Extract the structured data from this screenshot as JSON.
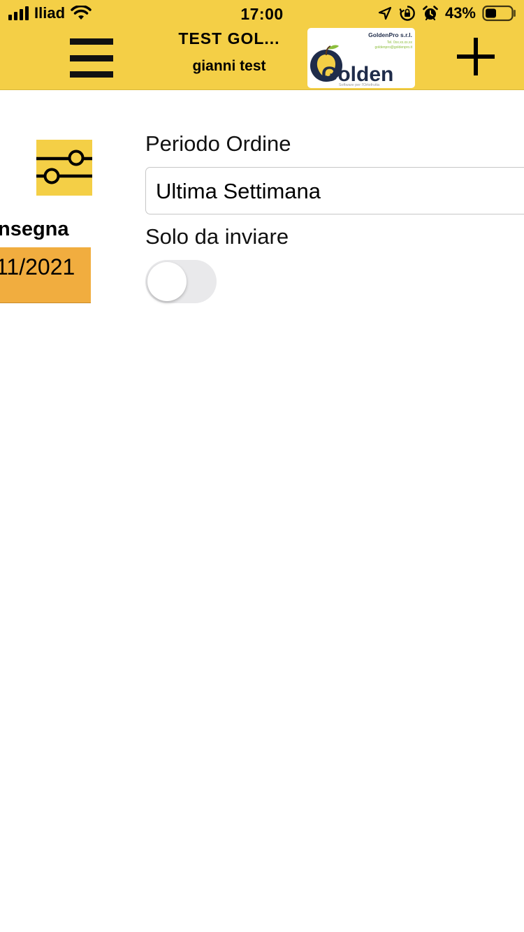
{
  "status_bar": {
    "carrier": "Iliad",
    "time": "17:00",
    "battery_percent": "43%",
    "battery_level": 0.43,
    "icons": [
      "signal-icon",
      "wifi-icon",
      "location-arrow-icon",
      "rotation-lock-icon",
      "alarm-icon",
      "battery-icon"
    ]
  },
  "header": {
    "title": "TEST GOL...",
    "subtitle": "gianni test",
    "logo": {
      "company": "GoldenPro s.r.l.",
      "phone": "Tel. 0xx.xx.xx.xx",
      "email": "goldenpro@goldenpro.it",
      "brand": "Golden",
      "tagline": "Software per l'Ortofrutta"
    },
    "menu_icon": "hamburger-menu-icon",
    "add_icon": "plus-icon"
  },
  "filter": {
    "icon": "filter-sliders-icon",
    "column_header": "nsegna",
    "date_value": "11/2021"
  },
  "form": {
    "period_label": "Periodo Ordine",
    "period_value": "Ultima Settimana",
    "only_to_send_label": "Solo da inviare",
    "only_to_send_on": false
  },
  "colors": {
    "header_yellow": "#f4cf46",
    "date_cell_orange": "#f1ad3f",
    "toggle_off": "#e9e9eb"
  }
}
